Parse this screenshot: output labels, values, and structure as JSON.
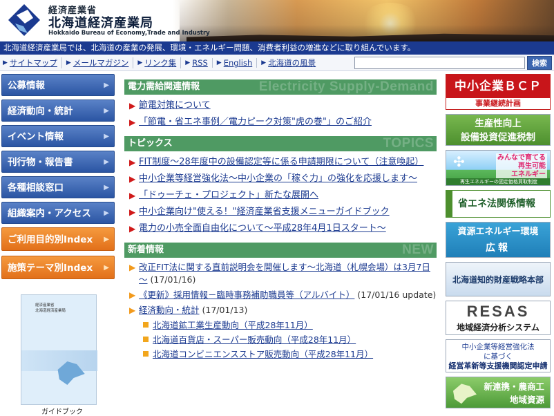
{
  "header": {
    "agency_top": "経済産業省",
    "agency_main": "北海道経済産業局",
    "agency_en": "Hokkaido Bureau of Economy,Trade and Industry",
    "logo_icon": "hokkaido-bureau-logo-icon",
    "brand_color": "#1b3a90"
  },
  "tagline": "北海道経済産業局では、北海道の産業の発展、環境・エネルギー問題、消費者利益の増進などに取り組んでいます。",
  "utilnav": {
    "items": [
      {
        "label": "サイトマップ"
      },
      {
        "label": "メールマガジン"
      },
      {
        "label": "リンク集"
      },
      {
        "label": "RSS"
      },
      {
        "label": "English"
      },
      {
        "label": "北海道の風景"
      }
    ],
    "search_value": "",
    "search_button": "検索"
  },
  "leftnav": {
    "items": [
      {
        "label": "公募情報"
      },
      {
        "label": "経済動向・統計"
      },
      {
        "label": "イベント情報"
      },
      {
        "label": "刊行物・報告書"
      },
      {
        "label": "各種相談窓口"
      },
      {
        "label": "組織案内・アクセス"
      }
    ],
    "index_items": [
      {
        "label": "ご利用目的別Index"
      },
      {
        "label": "施策テーマ別Index"
      }
    ],
    "guidebook": {
      "book_title_1": "経済産業省",
      "book_title_2": "北海道経済産業局",
      "label": "ガイドブック"
    }
  },
  "main": {
    "electricity": {
      "title": "電力需給関連情報",
      "ghost": "Electricity Supply-Demand",
      "items": [
        {
          "label": "節電対策について"
        },
        {
          "label": "「節電・省エネ事例／電力ピーク対策\"虎の巻\"」のご紹介"
        }
      ]
    },
    "topics": {
      "title": "トピックス",
      "ghost": "TOPICS",
      "items": [
        {
          "label": "FIT制度～28年度中の設備認定等に係る申請期限について（注意喚起）"
        },
        {
          "label": "中小企業等経営強化法～中小企業の「稼ぐ力」の強化を応援します～"
        },
        {
          "label": "「ドゥーチェ・プロジェクト」新たな展開へ"
        },
        {
          "label": "中小企業向け\"使える！\"経済産業省支援メニューガイドブック"
        },
        {
          "label": "電力の小売全面自由化について～平成28年4月1日スタート～"
        }
      ]
    },
    "news": {
      "title": "新着情報",
      "ghost": "NEW",
      "items": [
        {
          "label": "改正FIT法に関する直前説明会を開催します～北海道（札幌会場）は3月7日～",
          "date": " (17/01/16)"
        },
        {
          "label": "《更新》採用情報－臨時事務補助職員等（アルバイト）",
          "date": " (17/01/16 update)"
        },
        {
          "label": "経済動向・統計",
          "date": " (17/01/13)"
        }
      ],
      "sub_items": [
        {
          "label": "北海道鉱工業生産動向（平成28年11月）"
        },
        {
          "label": "北海道百貨店・スーパー販売動向（平成28年11月）"
        },
        {
          "label": "北海道コンビニエンスストア販売動向（平成28年11月）"
        }
      ]
    }
  },
  "banners": {
    "bcp_top": "中小企業ＢＣＰ",
    "bcp_bottom": "事業継続計画",
    "seisan_1": "生産性向上",
    "seisan_2": "設備投資促進税制",
    "saiene_1": "みんなで育てる",
    "saiene_2": "再生可能",
    "saiene_3": "エネルギー",
    "saiene_foot": "再生エネルギーの固定価格買取制度",
    "shoene": "省エネ法関係情報",
    "shigen_1": "資源エネルギー環境",
    "shigen_2": "広報",
    "chizai": "北海道知的財産戦略本部",
    "resas_1": "RESAS",
    "resas_2": "地域経済分析システム",
    "keiei_1": "中小企業等経営強化法",
    "keiei_2": "に基づく",
    "keiei_3": "経営革新等支援機関認定申請",
    "shinrenkei_1": "新連携・農商工",
    "shinrenkei_2": "地域資源"
  }
}
